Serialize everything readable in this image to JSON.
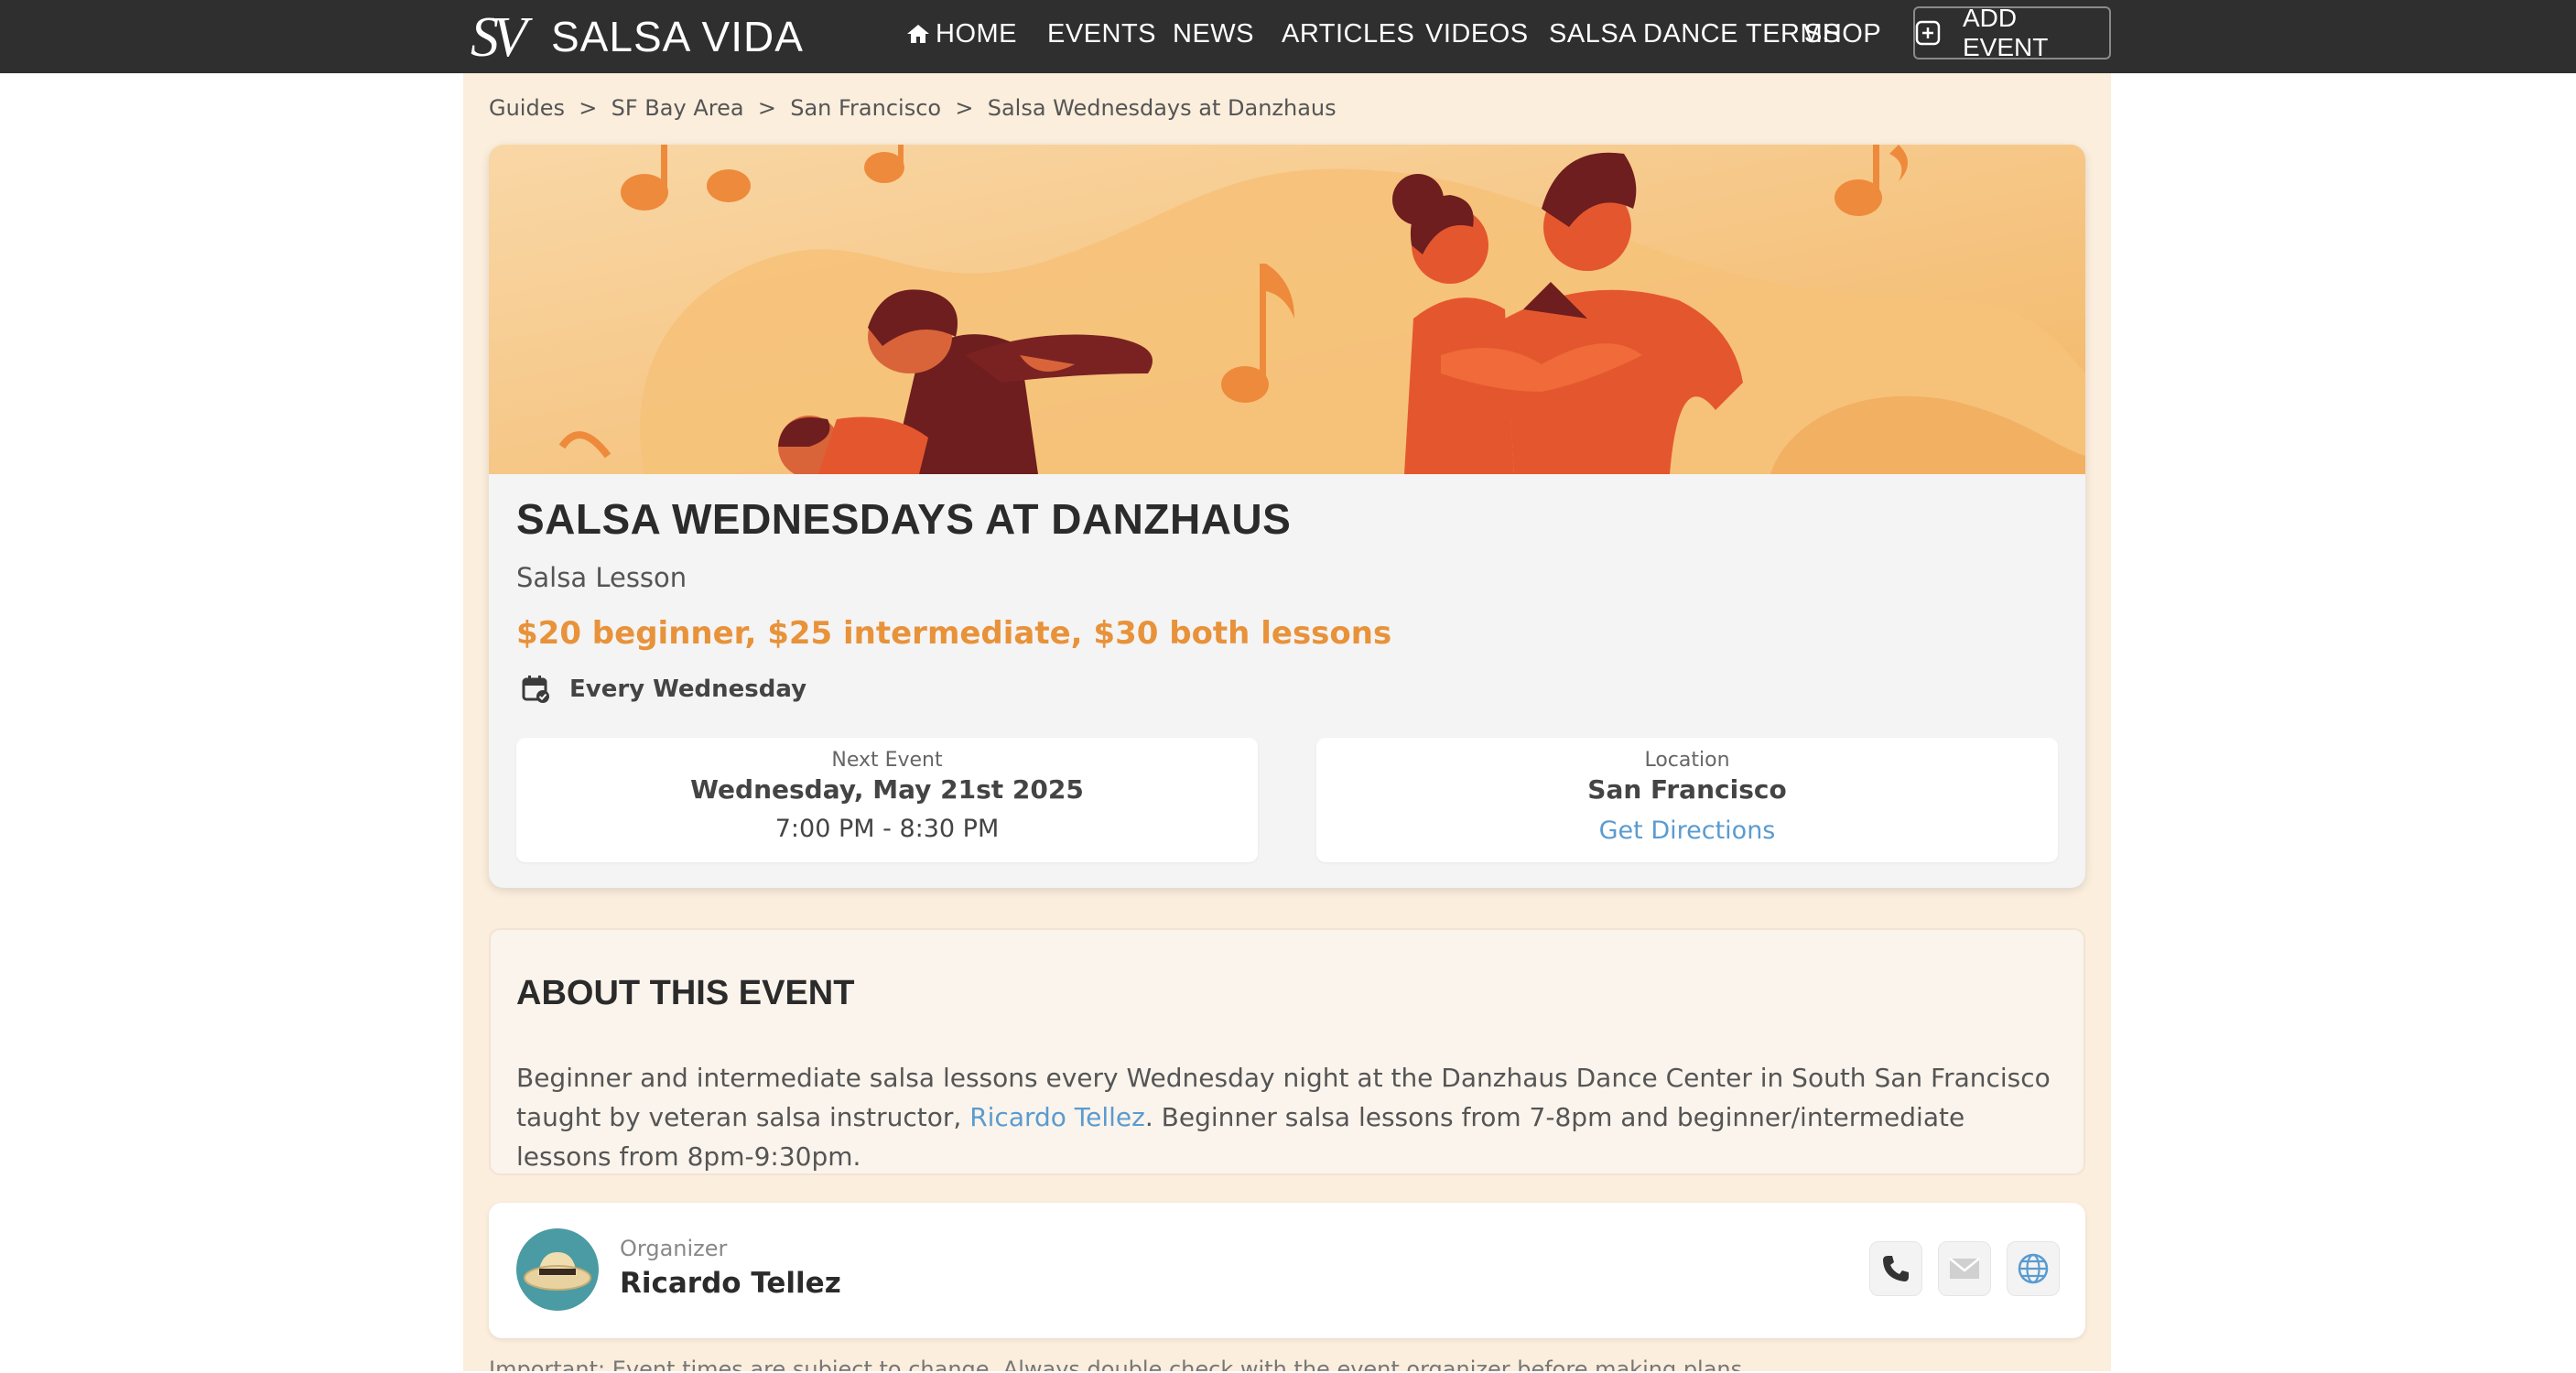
{
  "header": {
    "logo_text": "SALSA VIDA",
    "nav": [
      "HOME",
      "EVENTS",
      "NEWS",
      "ARTICLES",
      "VIDEOS",
      "SALSA DANCE TERMS",
      "SHOP"
    ],
    "add_event_label": "ADD EVENT"
  },
  "breadcrumb": {
    "items": [
      "Guides",
      "SF Bay Area",
      "San Francisco",
      "Salsa Wednesdays at Danzhaus"
    ],
    "separator": ">"
  },
  "event": {
    "title": "SALSA WEDNESDAYS AT DANZHAUS",
    "type": "Salsa Lesson",
    "price": "$20 beginner, $25 intermediate, $30 both lessons",
    "recurrence": "Every Wednesday",
    "next_event": {
      "label": "Next Event",
      "date": "Wednesday, May 21st 2025",
      "time": "7:00 PM - 8:30 PM"
    },
    "location": {
      "label": "Location",
      "city": "San Francisco",
      "directions_label": "Get Directions"
    }
  },
  "about": {
    "title": "ABOUT THIS EVENT",
    "text_before_link": "Beginner and intermediate salsa lessons every Wednesday night at the Danzhaus Dance Center in South San Francisco taught by veteran salsa instructor, ",
    "link_text": "Ricardo Tellez",
    "text_after_link": ". Beginner salsa lessons from 7-8pm and beginner/intermediate lessons from 8pm-9:30pm."
  },
  "organizer": {
    "label": "Organizer",
    "name": "Ricardo Tellez",
    "contact_icons": [
      "phone-icon",
      "email-icon",
      "globe-icon"
    ]
  },
  "disclaimer": "Important: Event times are subject to change. Always double check with the event organizer before making plans.",
  "colors": {
    "topbar": "#2f2f2f",
    "page_column": "#fbeedd",
    "price": "#e8923a",
    "link": "#5a9bd0",
    "hero_bg": "#f7c98e",
    "hero_figures": "#e4572e"
  }
}
